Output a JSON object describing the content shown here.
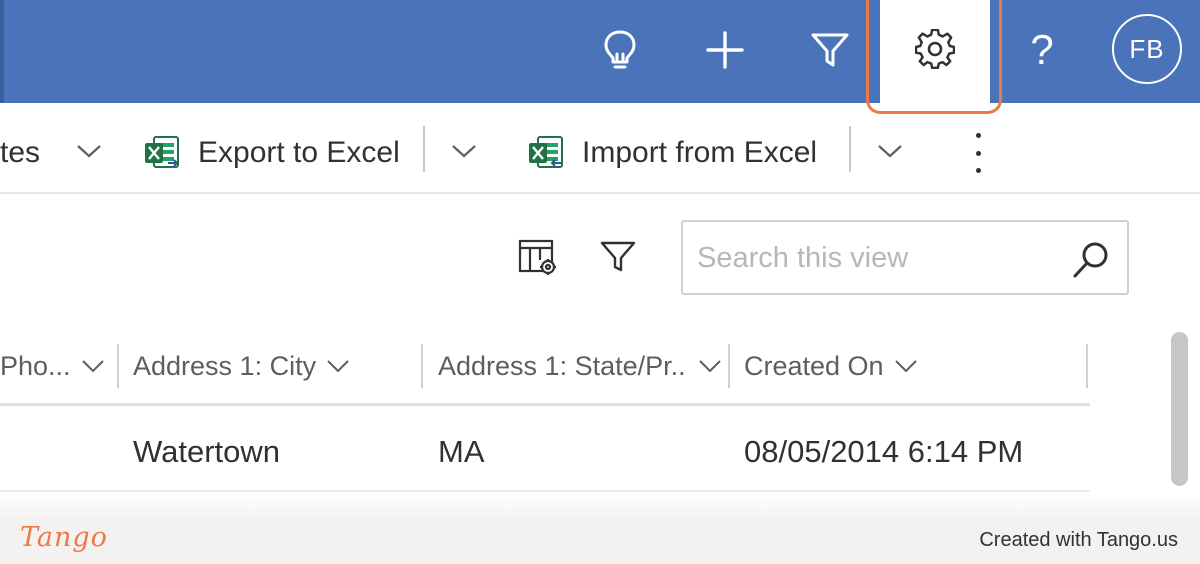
{
  "header": {
    "icons": [
      "lightbulb-icon",
      "plus-icon",
      "filter-icon",
      "settings-icon",
      "help-icon"
    ],
    "help_label": "?",
    "avatar_initials": "FB",
    "bar_color": "#4a73b9",
    "highlight_color": "#ec7a45"
  },
  "commandbar": {
    "truncated_label": "tes",
    "export_label": "Export to Excel",
    "import_label": "Import from Excel",
    "excel_icon_color": "#217346"
  },
  "view": {
    "search_placeholder": "Search this view"
  },
  "grid": {
    "columns": [
      {
        "label": "Pho..."
      },
      {
        "label": "Address 1: City"
      },
      {
        "label": "Address 1: State/Pr..."
      },
      {
        "label": "Created On"
      }
    ],
    "rows": [
      {
        "city": "Watertown",
        "state": "MA",
        "created_on": "08/05/2014 6:14 PM"
      }
    ]
  },
  "footer": {
    "logo_text": "Tango",
    "credit_text": "Created with Tango.us"
  }
}
